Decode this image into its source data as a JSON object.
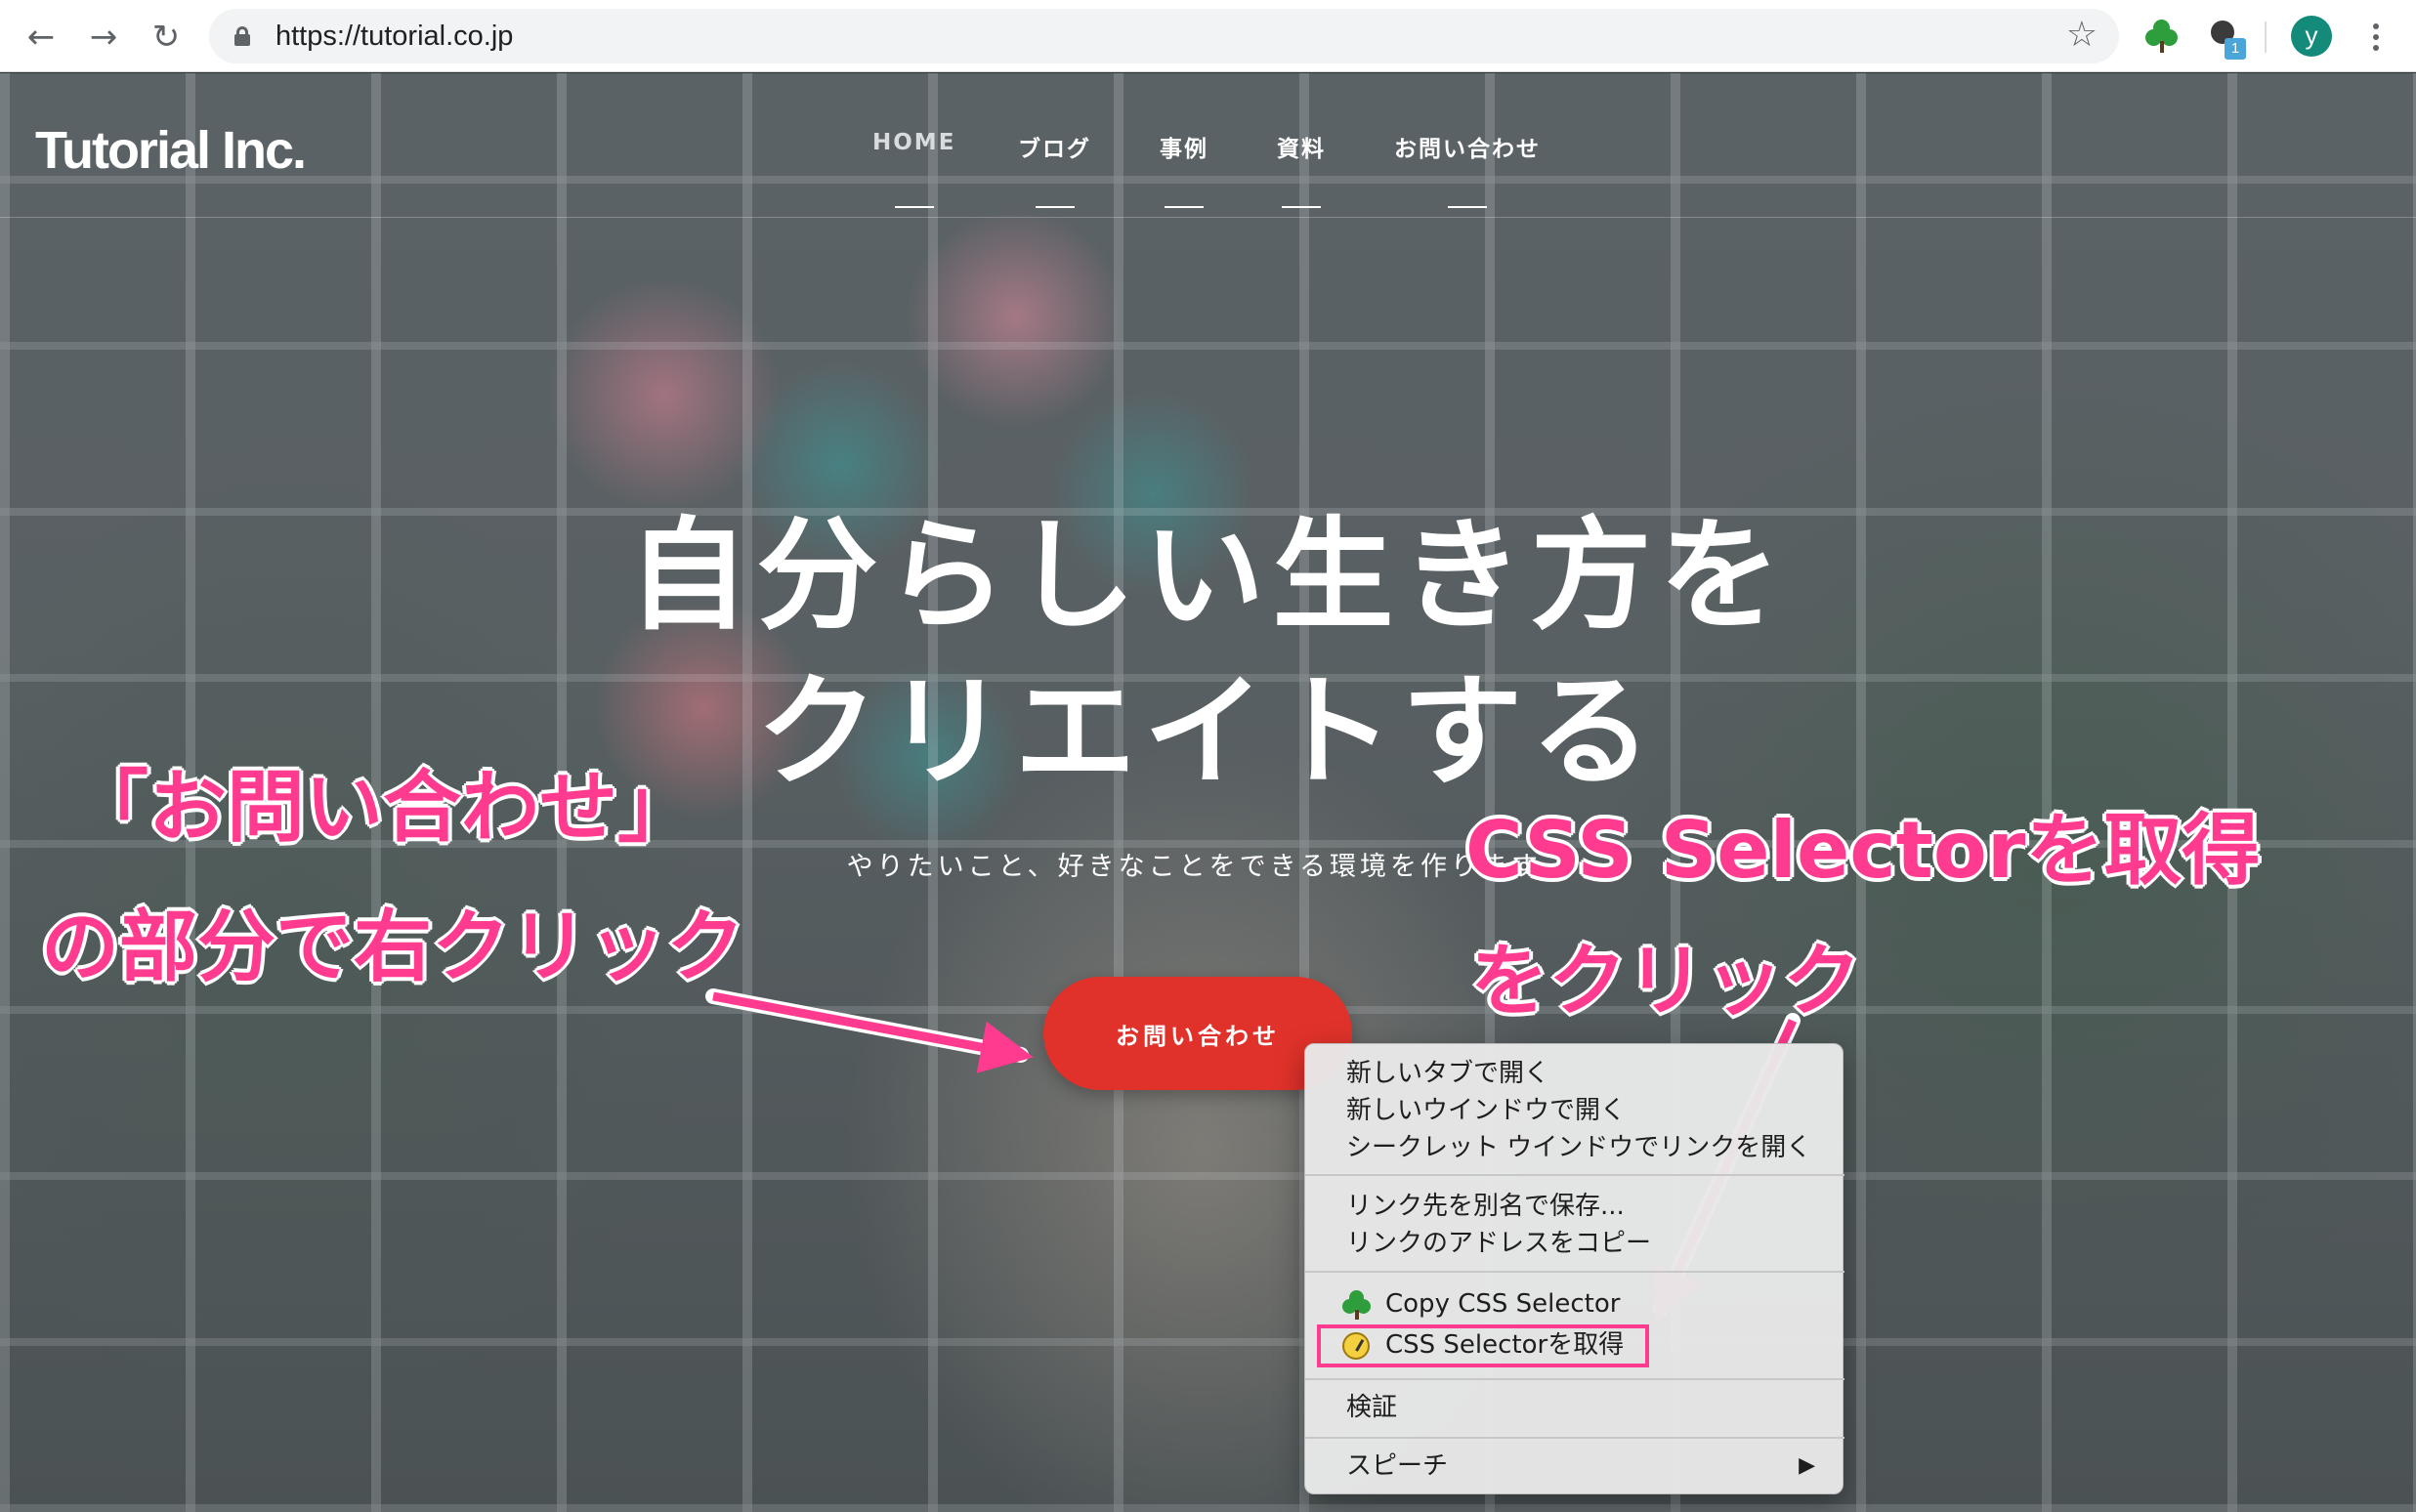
{
  "browser": {
    "url": "https://tutorial.co.jp",
    "back_icon": "←",
    "forward_icon": "→",
    "reload_icon": "↻",
    "star_icon": "☆",
    "extension_badge": "1",
    "avatar_letter": "y"
  },
  "site": {
    "logo": "Tutorial Inc.",
    "nav": [
      "HOME",
      "ブログ",
      "事例",
      "資料",
      "お問い合わせ"
    ],
    "headline_line1": "自分らしい生き方を",
    "headline_line2": "クリエイトする",
    "subline": "やりたいこと、好きなことをできる環境を作ります。",
    "cta_label": "お問い合わせ"
  },
  "annotations": {
    "left_line1": "「お問い合わせ」",
    "left_line2": "の部分で右クリック",
    "right_line1": "CSS Selectorを取得",
    "right_line2": "をクリック"
  },
  "context_menu": {
    "items": [
      "新しいタブで開く",
      "新しいウインドウで開く",
      "シークレット ウインドウでリンクを開く",
      "リンク先を別名で保存...",
      "リンクのアドレスをコピー",
      "Copy CSS Selector",
      "CSS Selectorを取得",
      "検証",
      "スピーチ"
    ],
    "submenu_arrow": "▶"
  },
  "colors": {
    "accent_pink": "#ff3b8f",
    "cta_red": "#e0322a",
    "avatar_teal": "#138a7a"
  },
  "icons": [
    "back-arrow-icon",
    "forward-arrow-icon",
    "reload-icon",
    "lock-icon",
    "star-icon",
    "tree-extension-icon",
    "pin-extension-icon",
    "kebab-menu-icon",
    "clock-icon"
  ]
}
